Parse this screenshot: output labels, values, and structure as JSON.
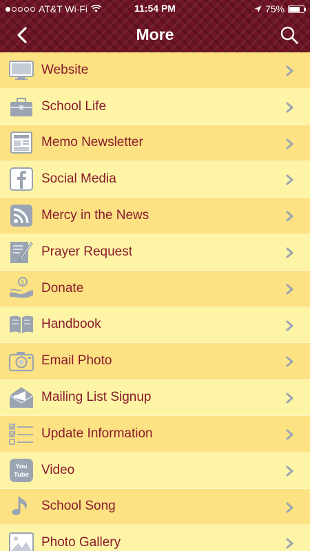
{
  "status": {
    "carrier": "AT&T Wi-Fi",
    "time": "11:54 PM",
    "battery": "75%",
    "battery_level": 0.75,
    "signal_bars": 1
  },
  "nav": {
    "title": "More",
    "back_icon": "chevron-left-icon",
    "search_icon": "search-icon"
  },
  "colors": {
    "header": "#6e1425",
    "row_odd": "#fde283",
    "row_even": "#fef4a6",
    "label": "#8a1a2c",
    "icon": "#9aa4b2"
  },
  "menu": {
    "items": [
      {
        "label": "Website",
        "icon": "monitor-icon"
      },
      {
        "label": "School Life",
        "icon": "briefcase-icon"
      },
      {
        "label": "Memo Newsletter",
        "icon": "newspaper-icon"
      },
      {
        "label": "Social Media",
        "icon": "facebook-icon"
      },
      {
        "label": "Mercy in the News",
        "icon": "rss-icon"
      },
      {
        "label": "Prayer Request",
        "icon": "form-pencil-icon"
      },
      {
        "label": "Donate",
        "icon": "donate-hand-icon"
      },
      {
        "label": "Handbook",
        "icon": "book-icon"
      },
      {
        "label": "Email Photo",
        "icon": "camera-icon"
      },
      {
        "label": "Mailing List Signup",
        "icon": "envelope-megaphone-icon"
      },
      {
        "label": "Update Information",
        "icon": "checklist-icon"
      },
      {
        "label": "Video",
        "icon": "youtube-icon",
        "icon_text": [
          "You",
          "Tube"
        ]
      },
      {
        "label": "School Song",
        "icon": "music-note-icon"
      },
      {
        "label": "Photo Gallery",
        "icon": "image-icon"
      }
    ]
  }
}
